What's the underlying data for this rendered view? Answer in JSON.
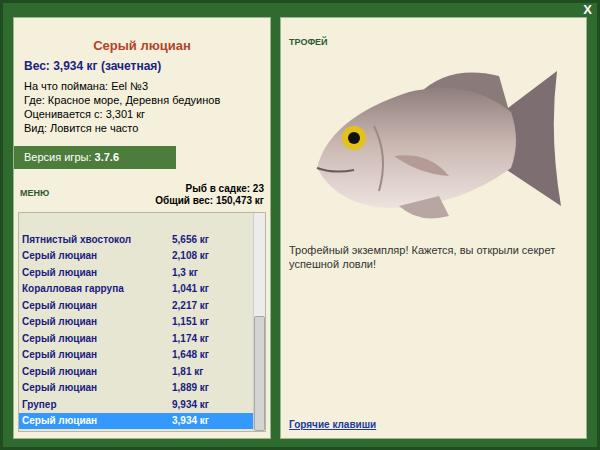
{
  "window": {
    "close": "X"
  },
  "fish": {
    "title": "Серый люциан",
    "weight": "Вес: 3,934 кг (зачетная)",
    "details": [
      "На что поймана: Eel №3",
      "Где: Красное море, Деревня бедуинов",
      "Оценивается с: 3,301 кг",
      "Вид: Ловится не часто"
    ]
  },
  "version": {
    "label": "Версия игры:",
    "value": "3.7.6"
  },
  "menu": "МЕНЮ",
  "keepnet": {
    "count": "Рыб в садке: 23",
    "total": "Общий вес: 150,473 кг"
  },
  "catches": [
    {
      "name": "Пятнистый хвостокол",
      "weight": "5,656 кг",
      "selected": false
    },
    {
      "name": "Серый люциан",
      "weight": "2,108 кг",
      "selected": false
    },
    {
      "name": "Серый люциан",
      "weight": "1,3 кг",
      "selected": false
    },
    {
      "name": "Коралловая гаррупа",
      "weight": "1,041 кг",
      "selected": false
    },
    {
      "name": "Серый люциан",
      "weight": "2,217 кг",
      "selected": false
    },
    {
      "name": "Серый люциан",
      "weight": "1,151 кг",
      "selected": false
    },
    {
      "name": "Серый люциан",
      "weight": "1,174 кг",
      "selected": false
    },
    {
      "name": "Серый люциан",
      "weight": "1,648 кг",
      "selected": false
    },
    {
      "name": "Серый люциан",
      "weight": "1,81 кг",
      "selected": false
    },
    {
      "name": "Серый люциан",
      "weight": "1,889 кг",
      "selected": false
    },
    {
      "name": "Групер",
      "weight": "9,934 кг",
      "selected": false
    },
    {
      "name": "Серый люциан",
      "weight": "3,934 кг",
      "selected": true
    }
  ],
  "scrollbar": {
    "level": 1,
    "visible_share": 0.52
  },
  "trophy": {
    "label": "ТРОФЕЙ",
    "message": "Трофейный экземпляр! Кажется, вы открыли секрет успешной ловли!"
  },
  "hotkeys": "Горячие клавиши"
}
